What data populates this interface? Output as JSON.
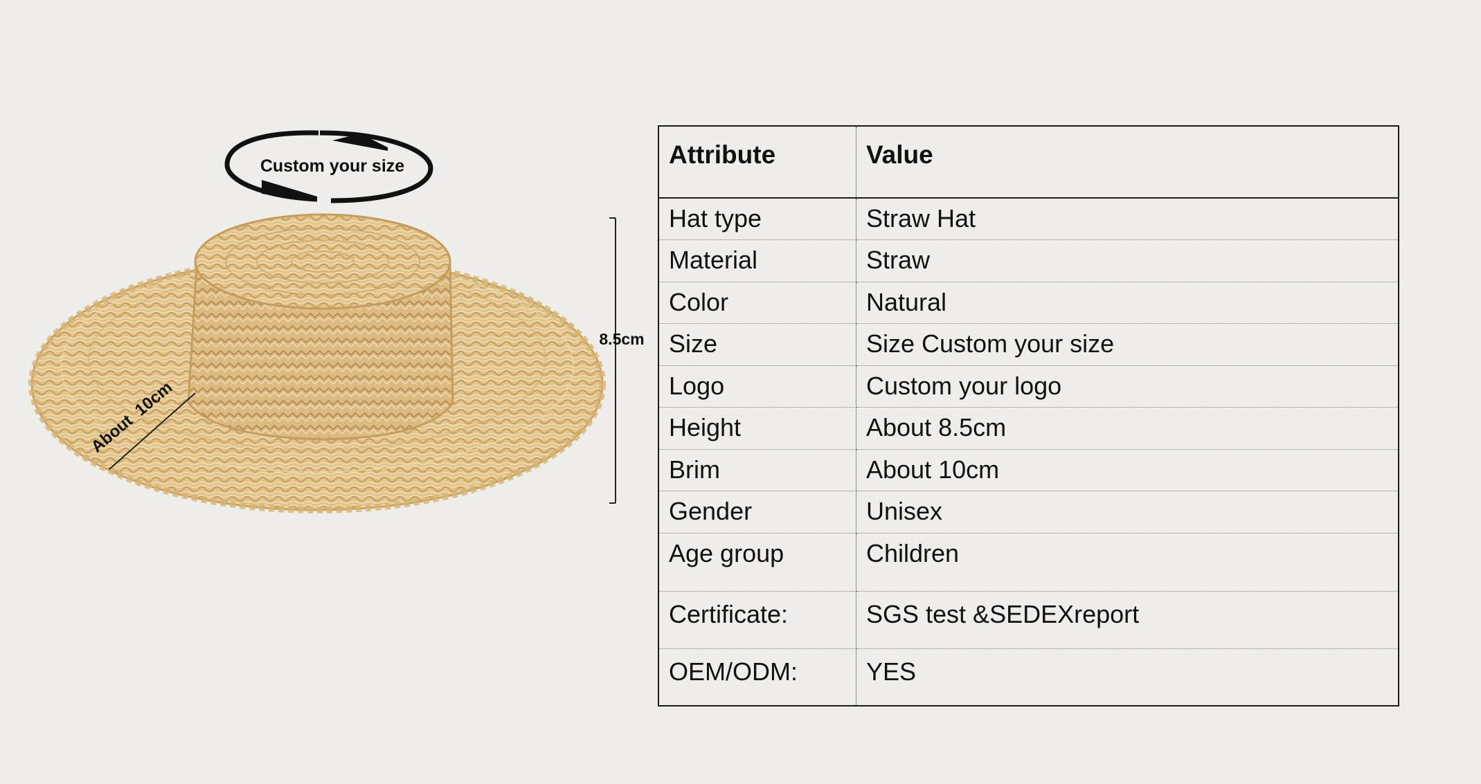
{
  "image": {
    "subject": "straw boater hat"
  },
  "annotations": {
    "top_arrow_label": "Custom your size",
    "height_label": "8.5cm",
    "brim_label": "About  10cm"
  },
  "table": {
    "headers": {
      "attribute": "Attribute",
      "value": "Value"
    },
    "rows": [
      {
        "attribute": "Hat type",
        "value": "Straw Hat"
      },
      {
        "attribute": "Material",
        "value": "Straw"
      },
      {
        "attribute": "Color",
        "value": "Natural"
      },
      {
        "attribute": "Size",
        "value": "Size Custom your size"
      },
      {
        "attribute": "Logo",
        "value": "Custom your logo"
      },
      {
        "attribute": "Height",
        "value": "About 8.5cm"
      },
      {
        "attribute": "Brim",
        "value": "About 10cm"
      },
      {
        "attribute": "Gender",
        "value": "Unisex"
      },
      {
        "attribute": "Age group",
        "value": "Children"
      },
      {
        "attribute": "Certificate:",
        "value": "SGS test &SEDEXreport"
      },
      {
        "attribute": "OEM/ODM:",
        "value": "YES"
      }
    ]
  },
  "colors": {
    "background": "#efede9",
    "straw": "#e3c48e",
    "straw_dark": "#c9a366",
    "line": "#1a1a1a"
  }
}
